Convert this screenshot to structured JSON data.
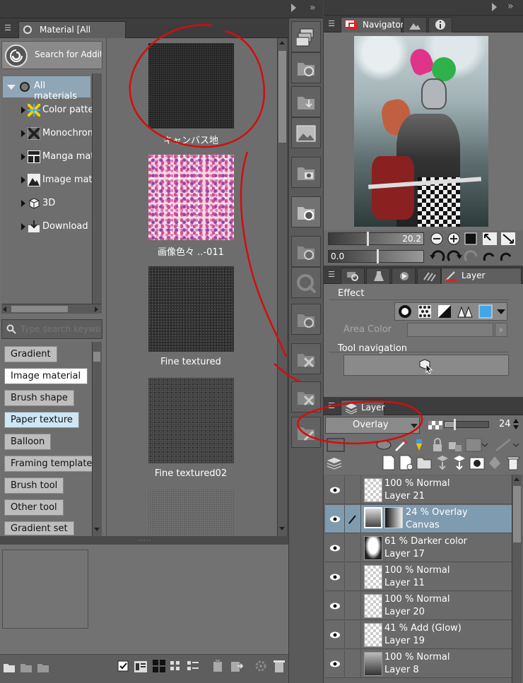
{
  "material_panel": {
    "tab_title": "Material [All materials]",
    "search_additional": "Search for Additional",
    "tree": [
      {
        "label": "All materials",
        "icon": "all-materials-icon"
      },
      {
        "label": "Color pattern",
        "icon": "color-pattern-icon"
      },
      {
        "label": "Monochrome",
        "icon": "monochrome-icon"
      },
      {
        "label": "Manga material",
        "icon": "manga-material-icon"
      },
      {
        "label": "Image material",
        "icon": "image-material-icon"
      },
      {
        "label": "3D",
        "icon": "3d-cube-icon"
      },
      {
        "label": "Download",
        "icon": "download-icon"
      }
    ],
    "search_placeholder": "Type search keywords",
    "tags": [
      {
        "label": "Gradient"
      },
      {
        "label": "Image material"
      },
      {
        "label": "Brush shape"
      },
      {
        "label": "Paper texture"
      },
      {
        "label": "Balloon"
      },
      {
        "label": "Framing template"
      },
      {
        "label": "Brush tool"
      },
      {
        "label": "Other tool"
      },
      {
        "label": "Gradient set"
      }
    ],
    "materials": [
      {
        "caption": "キャンバス地"
      },
      {
        "caption": "画像色々 ..-011"
      },
      {
        "caption": "Fine textured"
      },
      {
        "caption": "Fine textured02"
      },
      {
        "caption": ""
      }
    ]
  },
  "navigator": {
    "tab_title": "Navigator",
    "zoom_value": "20.2",
    "rotation_value": "0.0"
  },
  "layer_property": {
    "tab_title": "Layer Property",
    "effect_label": "Effect",
    "area_color_label": "Area Color",
    "tool_navigation_label": "Tool navigation"
  },
  "layer_panel": {
    "tab_title": "Layer",
    "blend_mode": "Overlay",
    "opacity": "24",
    "layers": [
      {
        "mode": "100 % Normal",
        "name": "Layer 21",
        "selected": false
      },
      {
        "mode": "24 % Overlay",
        "name": "Canvas",
        "selected": true
      },
      {
        "mode": "61 % Darker color",
        "name": "Layer 17",
        "selected": false
      },
      {
        "mode": "100 % Normal",
        "name": "Layer 11",
        "selected": false
      },
      {
        "mode": "100 % Normal",
        "name": "Layer 20",
        "selected": false
      },
      {
        "mode": "41 % Add (Glow)",
        "name": "Layer 19",
        "selected": false
      },
      {
        "mode": "100 % Normal",
        "name": "Layer 8",
        "selected": false
      }
    ]
  },
  "colors": {
    "panel_bg": "#727272",
    "selected_layer": "#7e9bb0",
    "annotation_red": "#d40d0d"
  }
}
